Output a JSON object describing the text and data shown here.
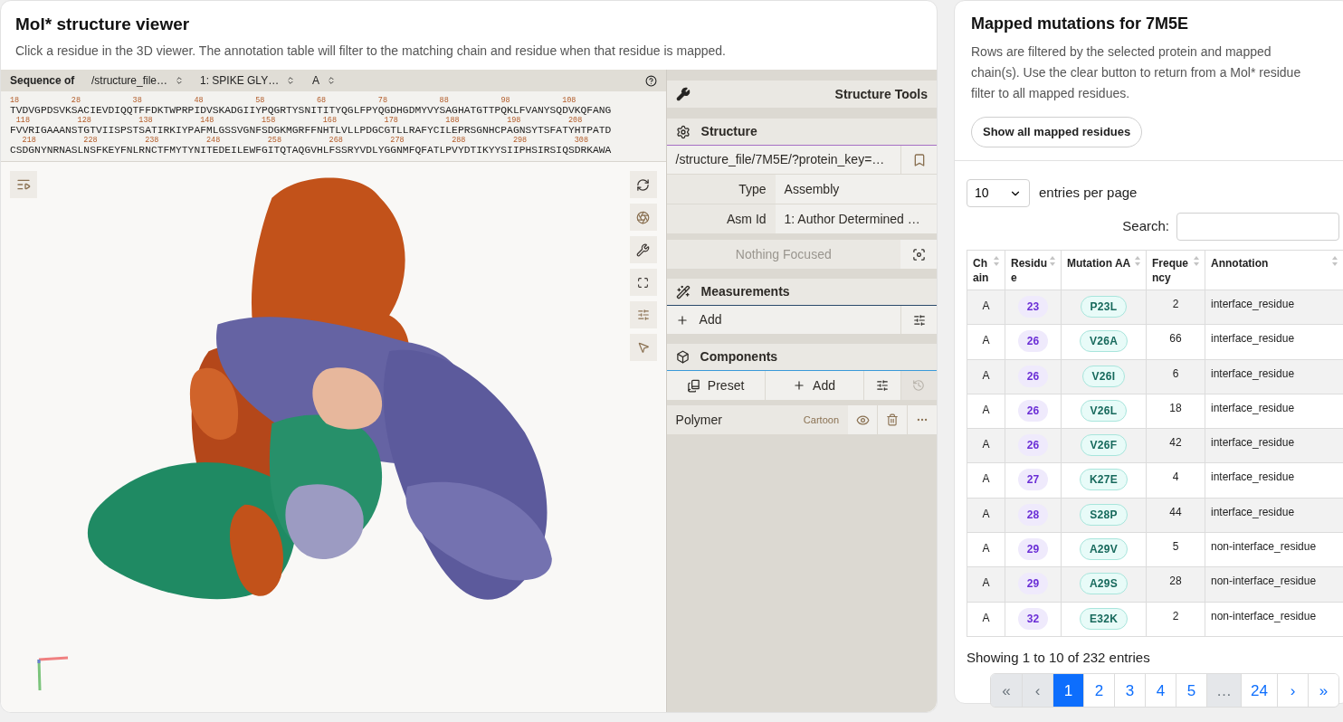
{
  "viewer_card": {
    "title": "Mol* structure viewer",
    "description": "Click a residue in the 3D viewer. The annotation table will filter to the matching chain and residue when that residue is mapped."
  },
  "sequence_panel": {
    "label": "Sequence of",
    "selects": [
      "/structure_file…",
      "1: SPIKE GLY…",
      "A"
    ],
    "lines": [
      {
        "numbers": [
          "18",
          "28",
          "38",
          "48",
          "58",
          "68",
          "78",
          "88",
          "98",
          "108"
        ],
        "residues": "TVDVGPDSVKSACIEVDIQQTFFDKTWPRPIDVSKADGIIYPQGRTYSNITITYQGLFPYQGDHGDMYVYSAGHATGTTPQKLFVANYSQDVKQFANG"
      },
      {
        "numbers": [
          "118",
          "128",
          "138",
          "148",
          "158",
          "168",
          "178",
          "188",
          "198",
          "208"
        ],
        "residues": "FVVRIGAAANSTGTVIISPSTSATIRKIYPAFMLGSSVGNFSDGKMGRFFNHTLVLLPDGCGTLLRAFYCILEPRSGNHCPAGNSYTSFATYHTPATD"
      },
      {
        "numbers": [
          "218",
          "228",
          "238",
          "248",
          "258",
          "268",
          "278",
          "288",
          "298",
          "308"
        ],
        "residues": "CSDGNYNRNASLNSFKEYFNLRNCTFMYTYNITEDEILEWFGITQTAQGVHLFSSRYVDLYGGNMFQFATLPVYDTIKYYSIIPHSIRSIQSDRKAWA"
      }
    ]
  },
  "structure_tools": {
    "title": "Structure Tools",
    "structure": {
      "heading": "Structure",
      "source": "/structure_file/7M5E/?protein_key=…",
      "fields": [
        {
          "label": "Type",
          "value": "Assembly"
        },
        {
          "label": "Asm Id",
          "value": "1: Author Determined …"
        }
      ],
      "focus": "Nothing Focused"
    },
    "measurements": {
      "heading": "Measurements",
      "add": "Add"
    },
    "components": {
      "heading": "Components",
      "actions": [
        {
          "kind": "preset",
          "label": "Preset"
        },
        {
          "kind": "add",
          "label": "Add"
        }
      ],
      "items": [
        {
          "name": "Polymer",
          "representation": "Cartoon"
        }
      ]
    }
  },
  "mutations_card": {
    "title": "Mapped mutations for 7M5E",
    "description": "Rows are filtered by the selected protein and mapped chain(s). Use the clear button to return from a Mol* residue filter to all mapped residues.",
    "clear_button": "Show all mapped residues",
    "page_size": "10",
    "page_size_label": "entries per page",
    "search_label": "Search:",
    "columns": [
      "Chain",
      "Residue",
      "Mutation AA",
      "Frequency",
      "Annotation"
    ],
    "rows": [
      {
        "chain": "A",
        "residue": "23",
        "mutation": "P23L",
        "frequency": "2",
        "annotation": "interface_residue"
      },
      {
        "chain": "A",
        "residue": "26",
        "mutation": "V26A",
        "frequency": "66",
        "annotation": "interface_residue"
      },
      {
        "chain": "A",
        "residue": "26",
        "mutation": "V26I",
        "frequency": "6",
        "annotation": "interface_residue"
      },
      {
        "chain": "A",
        "residue": "26",
        "mutation": "V26L",
        "frequency": "18",
        "annotation": "interface_residue"
      },
      {
        "chain": "A",
        "residue": "26",
        "mutation": "V26F",
        "frequency": "42",
        "annotation": "interface_residue"
      },
      {
        "chain": "A",
        "residue": "27",
        "mutation": "K27E",
        "frequency": "4",
        "annotation": "interface_residue"
      },
      {
        "chain": "A",
        "residue": "28",
        "mutation": "S28P",
        "frequency": "44",
        "annotation": "interface_residue"
      },
      {
        "chain": "A",
        "residue": "29",
        "mutation": "A29V",
        "frequency": "5",
        "annotation": "non-interface_residue"
      },
      {
        "chain": "A",
        "residue": "29",
        "mutation": "A29S",
        "frequency": "28",
        "annotation": "non-interface_residue"
      },
      {
        "chain": "A",
        "residue": "32",
        "mutation": "E32K",
        "frequency": "2",
        "annotation": "non-interface_residue"
      }
    ],
    "summary": "Showing 1 to 10 of 232 entries",
    "pagination": [
      {
        "label": "«",
        "selected": false,
        "disabled": true
      },
      {
        "label": "‹",
        "selected": false,
        "disabled": true
      },
      {
        "label": "1",
        "selected": true,
        "disabled": false
      },
      {
        "label": "2",
        "selected": false,
        "disabled": false
      },
      {
        "label": "3",
        "selected": false,
        "disabled": false
      },
      {
        "label": "4",
        "selected": false,
        "disabled": false
      },
      {
        "label": "5",
        "selected": false,
        "disabled": false
      },
      {
        "label": "…",
        "selected": false,
        "disabled": true
      },
      {
        "label": "24",
        "selected": false,
        "disabled": false
      },
      {
        "label": "›",
        "selected": false,
        "disabled": false
      },
      {
        "label": "»",
        "selected": false,
        "disabled": false
      }
    ]
  }
}
